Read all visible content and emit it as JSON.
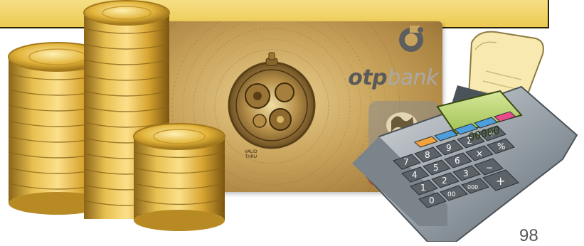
{
  "card": {
    "brand_otp": "otp",
    "brand_bank": "bank",
    "valid_thru": "VALID\nTHRU"
  },
  "calculator": {
    "display_value": "00000",
    "keys": [
      "7",
      "8",
      "9",
      "Σ",
      "+",
      "4",
      "5",
      "6",
      "×",
      "%",
      "1",
      "2",
      "3",
      "−",
      "0",
      "00",
      "000",
      "+"
    ]
  },
  "page": {
    "number": "98"
  },
  "colors": {
    "banner_fill": "#eccb52",
    "banner_border": "#2a2209",
    "gold": "#c9a45c",
    "coin_gold": "#e2b43a",
    "otp_green_display": "#b9d36a",
    "calc_body": "#9aa3aa"
  },
  "icons": [
    "coin-stack-icon",
    "otp-logo-icon",
    "pocket-watch-icon",
    "calculator-icon",
    "receipt-paper-icon"
  ]
}
